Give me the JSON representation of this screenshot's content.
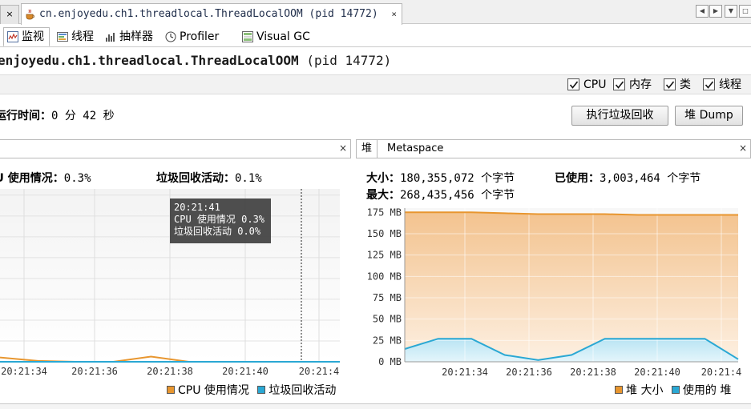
{
  "doc_tabs": {
    "stub_close": "×",
    "active_tab": "cn.enjoyedu.ch1.threadlocal.ThreadLocalOOM (pid 14772)",
    "close": "×",
    "nav_left": "◀",
    "nav_right": "▶",
    "nav_menu": "▼",
    "nav_restore": "□"
  },
  "sub_tabs": [
    {
      "label": "监视",
      "icon": "monitor-icon",
      "active": true
    },
    {
      "label": "线程",
      "icon": "threads-icon",
      "active": false
    },
    {
      "label": "抽样器",
      "icon": "sampler-icon",
      "active": false
    },
    {
      "label": "Profiler",
      "icon": "profiler-icon",
      "active": false
    },
    {
      "label": "Visual GC",
      "icon": "visual-gc-icon",
      "active": false
    }
  ],
  "app_title_bold": "enjoyedu.ch1.threadlocal.ThreadLocalOOM",
  "app_title_pid": "(pid 14772)",
  "checkboxes": [
    {
      "label": "CPU",
      "checked": true
    },
    {
      "label": "内存",
      "checked": true
    },
    {
      "label": "类",
      "checked": true
    },
    {
      "label": "线程",
      "checked": true
    }
  ],
  "uptime": {
    "label": "运行时间：",
    "value": "0 分 42 秒"
  },
  "buttons": {
    "gc": "执行垃圾回收",
    "heap_dump": "堆 Dump"
  },
  "cpu_panel": {
    "close": "×",
    "cpu_usage_label": "CPU 使用情况：",
    "cpu_usage_value": "0.3%",
    "gc_activity_label": "垃圾回收活动：",
    "gc_activity_value": "0.1%",
    "tooltip": {
      "time": "20:21:41",
      "cpu_line": "CPU 使用情况  0.3%",
      "gc_line": "垃圾回收活动  0.0%"
    },
    "legend": {
      "cpu": "CPU 使用情况",
      "gc": "垃圾回收活动"
    },
    "colors": {
      "cpu": "#e8962f",
      "gc": "#2aa8d4"
    }
  },
  "heap_panel": {
    "tabs": [
      "堆",
      "Metaspace"
    ],
    "close": "×",
    "size_label": "大小：",
    "size_value": "180,355,072 个字节",
    "max_label": "最大：",
    "max_value": "268,435,456 个字节",
    "used_label": "已使用：",
    "used_value": "3,003,464 个字节",
    "legend": {
      "heap_size": "堆 大小",
      "used_heap": "使用的 堆"
    },
    "colors": {
      "heap_size": "#e8962f",
      "used_heap": "#2aa8d4"
    }
  },
  "chart_data": [
    {
      "type": "line",
      "x_ticks": [
        "20:21:34",
        "20:21:36",
        "20:21:38",
        "20:21:40",
        "20:21:4"
      ],
      "series": [
        {
          "name": "CPU 使用情况",
          "values": [
            0.5,
            0.1,
            0.0,
            0.0,
            0.6,
            0.0,
            0.0,
            0.0,
            0.0,
            0.0
          ]
        },
        {
          "name": "垃圾回收活动",
          "values": [
            0.0,
            0.0,
            0.0,
            0.0,
            0.0,
            0.0,
            0.0,
            0.0,
            0.0,
            0.0
          ]
        }
      ],
      "ylim": [
        0,
        20
      ],
      "grid": true,
      "legend": "bottom-right"
    },
    {
      "type": "area",
      "y_ticks": [
        "0 MB",
        "25 MB",
        "50 MB",
        "75 MB",
        "100 MB",
        "125 MB",
        "150 MB",
        "175 MB"
      ],
      "x_ticks": [
        "20:21:34",
        "20:21:36",
        "20:21:38",
        "20:21:40",
        "20:21:4"
      ],
      "series": [
        {
          "name": "堆 大小",
          "values": [
            175,
            175,
            175,
            174,
            173,
            173,
            173,
            172,
            172,
            172,
            172
          ]
        },
        {
          "name": "使用的 堆",
          "values": [
            15,
            27,
            27,
            8,
            2,
            8,
            27,
            27,
            27,
            27,
            3
          ]
        }
      ],
      "ylim": [
        0,
        180
      ],
      "grid": true,
      "legend": "bottom-right"
    }
  ]
}
